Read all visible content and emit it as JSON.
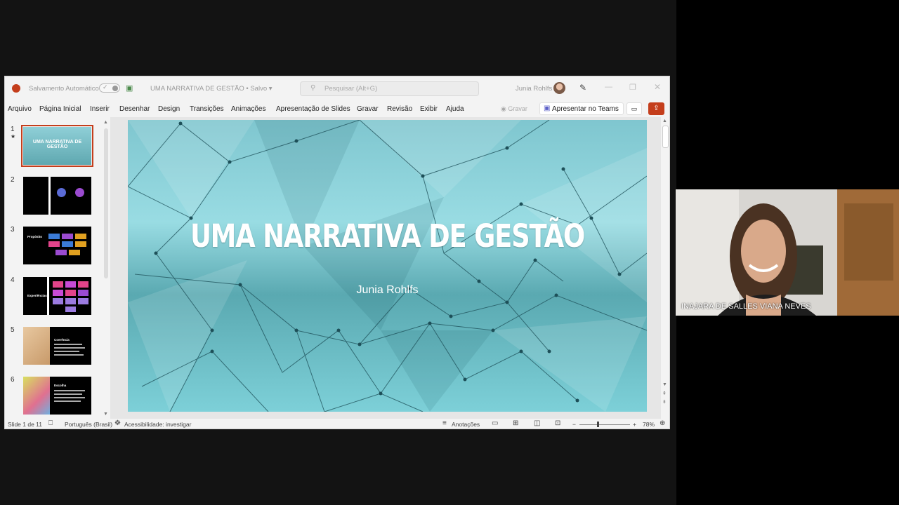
{
  "window": {
    "autosave_label": "Salvamento Automático",
    "doc_title": "UMA NARRATIVA DE GESTÃO • Salvo",
    "search_placeholder": "Pesquisar (Alt+G)",
    "user_name": "Junia Rohlfs"
  },
  "menu": {
    "items": [
      "Arquivo",
      "Página Inicial",
      "Inserir",
      "Desenhar",
      "Design",
      "Transições",
      "Animações",
      "Apresentação de Slides",
      "Gravar",
      "Revisão",
      "Exibir",
      "Ajuda"
    ],
    "record_label": "Gravar",
    "teams_label": "Apresentar no Teams"
  },
  "thumbnails": [
    {
      "number": "1",
      "star": "★",
      "title": "UMA NARRATIVA DE GESTÃO"
    },
    {
      "number": "2"
    },
    {
      "number": "3",
      "title": "Propósito"
    },
    {
      "number": "4",
      "title": "Experiências"
    },
    {
      "number": "5",
      "title": "Coerência"
    },
    {
      "number": "6",
      "title": "Escolha"
    }
  ],
  "slide": {
    "title": "UMA NARRATIVA DE GESTÃO",
    "subtitle": "Junia Rohlfs"
  },
  "status": {
    "slide_count": "Slide 1 de 11",
    "language": "Português (Brasil)",
    "accessibility": "Acessibilidade: investigar",
    "notes": "Anotações",
    "zoom": "78%"
  },
  "video": {
    "participant_name": "INAJARA DE SALLES VIANA NEVES"
  },
  "colors": {
    "accent": "#c43e1c",
    "slide_teal": "#7fc6cf"
  }
}
